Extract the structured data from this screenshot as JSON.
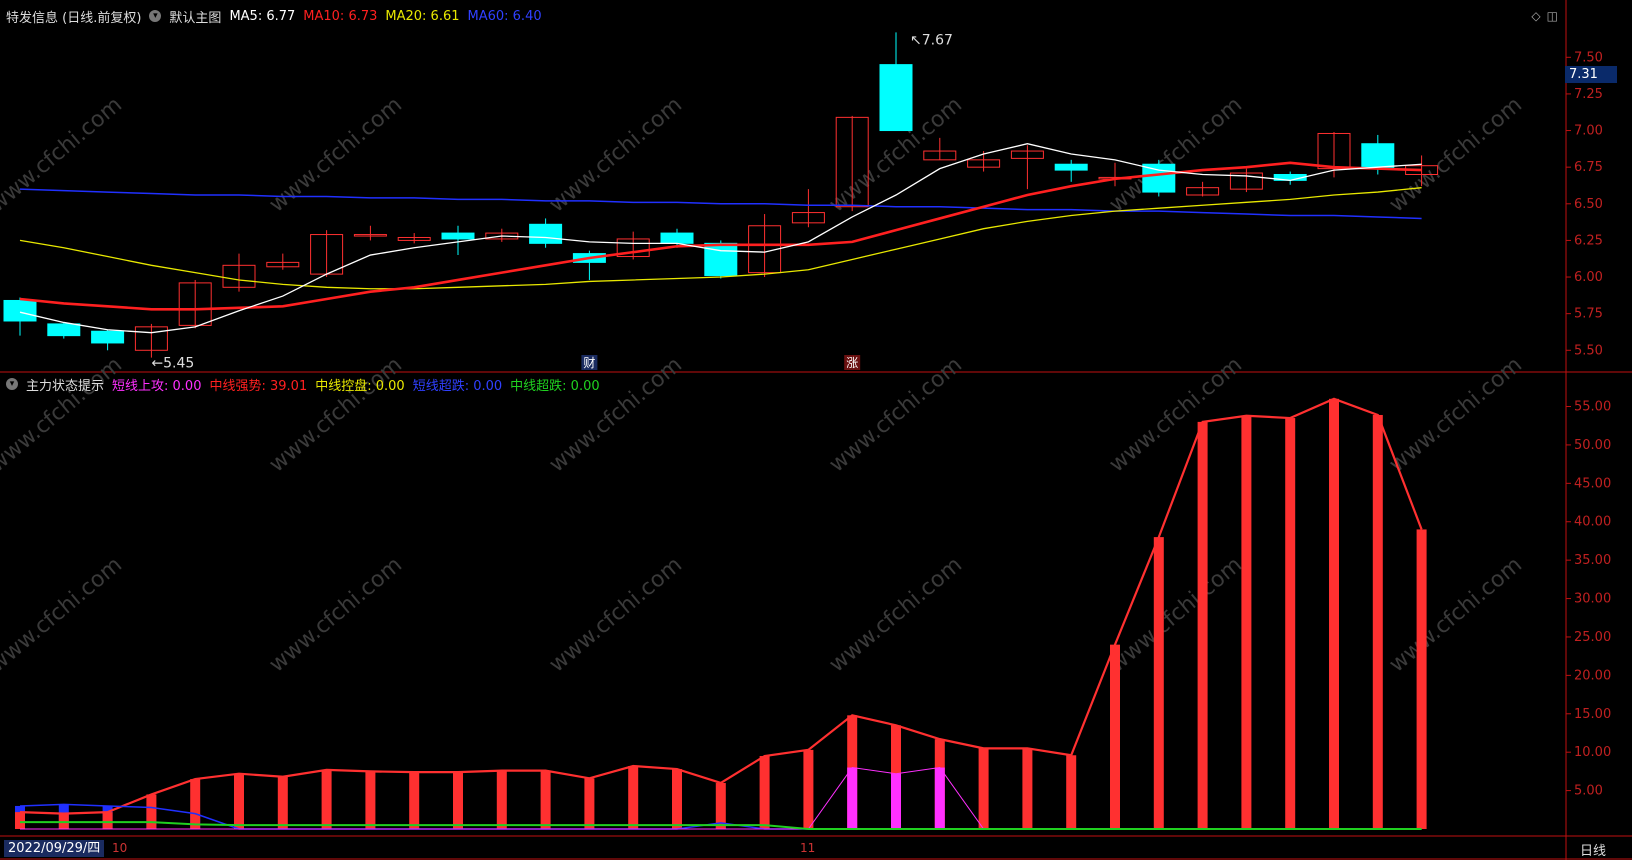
{
  "main_legend": {
    "title": "特发信息 (日线.前复权)",
    "template": "默认主图",
    "ma5": "MA5: 6.77",
    "ma10": "MA10: 6.73",
    "ma20": "MA20: 6.61",
    "ma60": "MA60: 6.40"
  },
  "sub_legend": {
    "title": "主力状态提示",
    "short_attack": "短线上攻: 0.00",
    "mid_strong": "中线强势: 39.01",
    "mid_control": "中线控盘: 0.00",
    "short_oversold": "短线超跌: 0.00",
    "mid_oversold": "中线超跌: 0.00"
  },
  "colors": {
    "ma5": "#ffffff",
    "ma10": "#ff2020",
    "ma20": "#e8e800",
    "ma60": "#2030ff",
    "up": "#ff3030",
    "down": "#00ffff",
    "axis": "#c01010",
    "magenta": "#ff30ff",
    "green": "#20d020"
  },
  "current_price": "7.31",
  "high_label": "7.67",
  "low_label": "5.45",
  "marker_cai": "财",
  "marker_zhang": "涨",
  "date_box": "2022/09/29/四",
  "month_labels": [
    "10",
    "11"
  ],
  "period": "日线",
  "watermark_text": "www.cfchi.com",
  "chart_data": [
    {
      "type": "candlestick",
      "y_ticks": [
        "7.50",
        "7.25",
        "7.00",
        "6.75",
        "6.50",
        "6.25",
        "6.00",
        "5.75",
        "5.50"
      ],
      "ylim": [
        5.42,
        7.7
      ],
      "candles": [
        [
          5.84,
          5.7,
          5.86,
          5.6
        ],
        [
          5.68,
          5.6,
          5.69,
          5.58
        ],
        [
          5.63,
          5.55,
          5.64,
          5.5
        ],
        [
          5.5,
          5.66,
          5.68,
          5.45
        ],
        [
          5.67,
          5.96,
          5.98,
          5.65
        ],
        [
          5.93,
          6.08,
          6.16,
          5.9
        ],
        [
          6.07,
          6.1,
          6.16,
          6.05
        ],
        [
          6.02,
          6.29,
          6.32,
          6.0
        ],
        [
          6.29,
          6.29,
          6.35,
          6.25
        ],
        [
          6.25,
          6.27,
          6.3,
          6.23
        ],
        [
          6.3,
          6.26,
          6.35,
          6.15
        ],
        [
          6.26,
          6.3,
          6.33,
          6.24
        ],
        [
          6.36,
          6.23,
          6.4,
          6.2
        ],
        [
          6.16,
          6.1,
          6.18,
          5.98
        ],
        [
          6.14,
          6.26,
          6.31,
          6.12
        ],
        [
          6.3,
          6.23,
          6.33,
          6.2
        ],
        [
          6.23,
          6.01,
          6.25,
          5.99
        ],
        [
          6.03,
          6.35,
          6.43,
          6.0
        ],
        [
          6.37,
          6.44,
          6.6,
          6.34
        ],
        [
          6.48,
          7.09,
          7.1,
          6.45
        ],
        [
          7.45,
          7.0,
          7.67,
          7.0
        ],
        [
          6.8,
          6.86,
          6.95,
          6.8
        ],
        [
          6.75,
          6.8,
          6.86,
          6.72
        ],
        [
          6.81,
          6.86,
          6.9,
          6.6
        ],
        [
          6.77,
          6.73,
          6.8,
          6.65
        ],
        [
          6.67,
          6.68,
          6.78,
          6.62
        ],
        [
          6.77,
          6.58,
          6.8,
          6.55
        ],
        [
          6.56,
          6.61,
          6.65,
          6.55
        ],
        [
          6.6,
          6.71,
          6.74,
          6.58
        ],
        [
          6.7,
          6.66,
          6.72,
          6.63
        ],
        [
          6.74,
          6.98,
          6.99,
          6.68
        ],
        [
          6.91,
          6.74,
          6.97,
          6.7
        ],
        [
          6.7,
          6.76,
          6.83,
          6.62
        ]
      ],
      "ma5": [
        5.76,
        5.69,
        5.64,
        5.62,
        5.66,
        5.77,
        5.87,
        6.02,
        6.15,
        6.2,
        6.24,
        6.28,
        6.27,
        6.24,
        6.23,
        6.23,
        6.18,
        6.17,
        6.24,
        6.41,
        6.56,
        6.74,
        6.84,
        6.91,
        6.84,
        6.8,
        6.73,
        6.7,
        6.69,
        6.66,
        6.73,
        6.75,
        6.77
      ],
      "ma10": [
        5.85,
        5.82,
        5.8,
        5.78,
        5.78,
        5.79,
        5.8,
        5.85,
        5.9,
        5.93,
        5.98,
        6.03,
        6.08,
        6.13,
        6.17,
        6.21,
        6.22,
        6.22,
        6.22,
        6.24,
        6.32,
        6.4,
        6.48,
        6.56,
        6.62,
        6.67,
        6.7,
        6.73,
        6.75,
        6.78,
        6.75,
        6.74,
        6.73
      ],
      "ma20": [
        6.25,
        6.2,
        6.14,
        6.08,
        6.03,
        5.98,
        5.95,
        5.93,
        5.92,
        5.92,
        5.93,
        5.94,
        5.95,
        5.97,
        5.98,
        5.99,
        6.0,
        6.02,
        6.05,
        6.12,
        6.19,
        6.26,
        6.33,
        6.38,
        6.42,
        6.45,
        6.47,
        6.49,
        6.51,
        6.53,
        6.56,
        6.58,
        6.61
      ],
      "ma60": [
        6.6,
        6.59,
        6.58,
        6.57,
        6.56,
        6.56,
        6.55,
        6.55,
        6.54,
        6.54,
        6.53,
        6.53,
        6.52,
        6.52,
        6.51,
        6.51,
        6.5,
        6.5,
        6.49,
        6.49,
        6.48,
        6.48,
        6.47,
        6.46,
        6.46,
        6.45,
        6.45,
        6.44,
        6.43,
        6.42,
        6.42,
        6.41,
        6.4
      ]
    },
    {
      "type": "bar",
      "title": "主力状态提示",
      "y_ticks": [
        "55.00",
        "50.00",
        "45.00",
        "40.00",
        "35.00",
        "30.00",
        "25.00",
        "20.00",
        "15.00",
        "10.00",
        "5.00"
      ],
      "ylim": [
        0,
        56.5
      ],
      "series": [
        {
          "name": "中线强势",
          "values": [
            2.2,
            2.0,
            2.2,
            4.5,
            6.5,
            7.2,
            6.8,
            7.7,
            7.5,
            7.4,
            7.4,
            7.6,
            7.6,
            6.6,
            8.2,
            7.8,
            6.0,
            9.5,
            10.3,
            14.8,
            13.5,
            11.7,
            10.5,
            10.5,
            9.6,
            24.0,
            38.0,
            53.0,
            53.8,
            53.5,
            56.0,
            53.9,
            39.0
          ]
        },
        {
          "name": "短线上攻",
          "values": [
            0,
            0,
            0,
            0,
            0,
            0,
            0,
            0,
            0,
            0,
            0,
            0,
            0,
            0,
            0,
            0,
            0,
            0,
            0,
            8.0,
            7.2,
            8.0,
            0,
            0,
            0,
            0,
            0,
            0,
            0,
            0,
            0,
            0,
            0
          ]
        },
        {
          "name": "短线超跌",
          "values": [
            3.0,
            3.2,
            3.0,
            2.8,
            2.0,
            0,
            0,
            0,
            0,
            0,
            0,
            0,
            0,
            0,
            0,
            0,
            0.8,
            0,
            0,
            0,
            0,
            0,
            0,
            0,
            0,
            0,
            0,
            0,
            0,
            0,
            0,
            0,
            0
          ]
        },
        {
          "name": "中线超跌",
          "values": [
            0.9,
            0.9,
            0.9,
            0.9,
            0.6,
            0.5,
            0.5,
            0.5,
            0.5,
            0.5,
            0.5,
            0.5,
            0.5,
            0.5,
            0.5,
            0.5,
            0.5,
            0.5,
            0,
            0,
            0,
            0,
            0,
            0,
            0,
            0,
            0,
            0,
            0,
            0,
            0,
            0,
            0
          ]
        }
      ]
    }
  ]
}
